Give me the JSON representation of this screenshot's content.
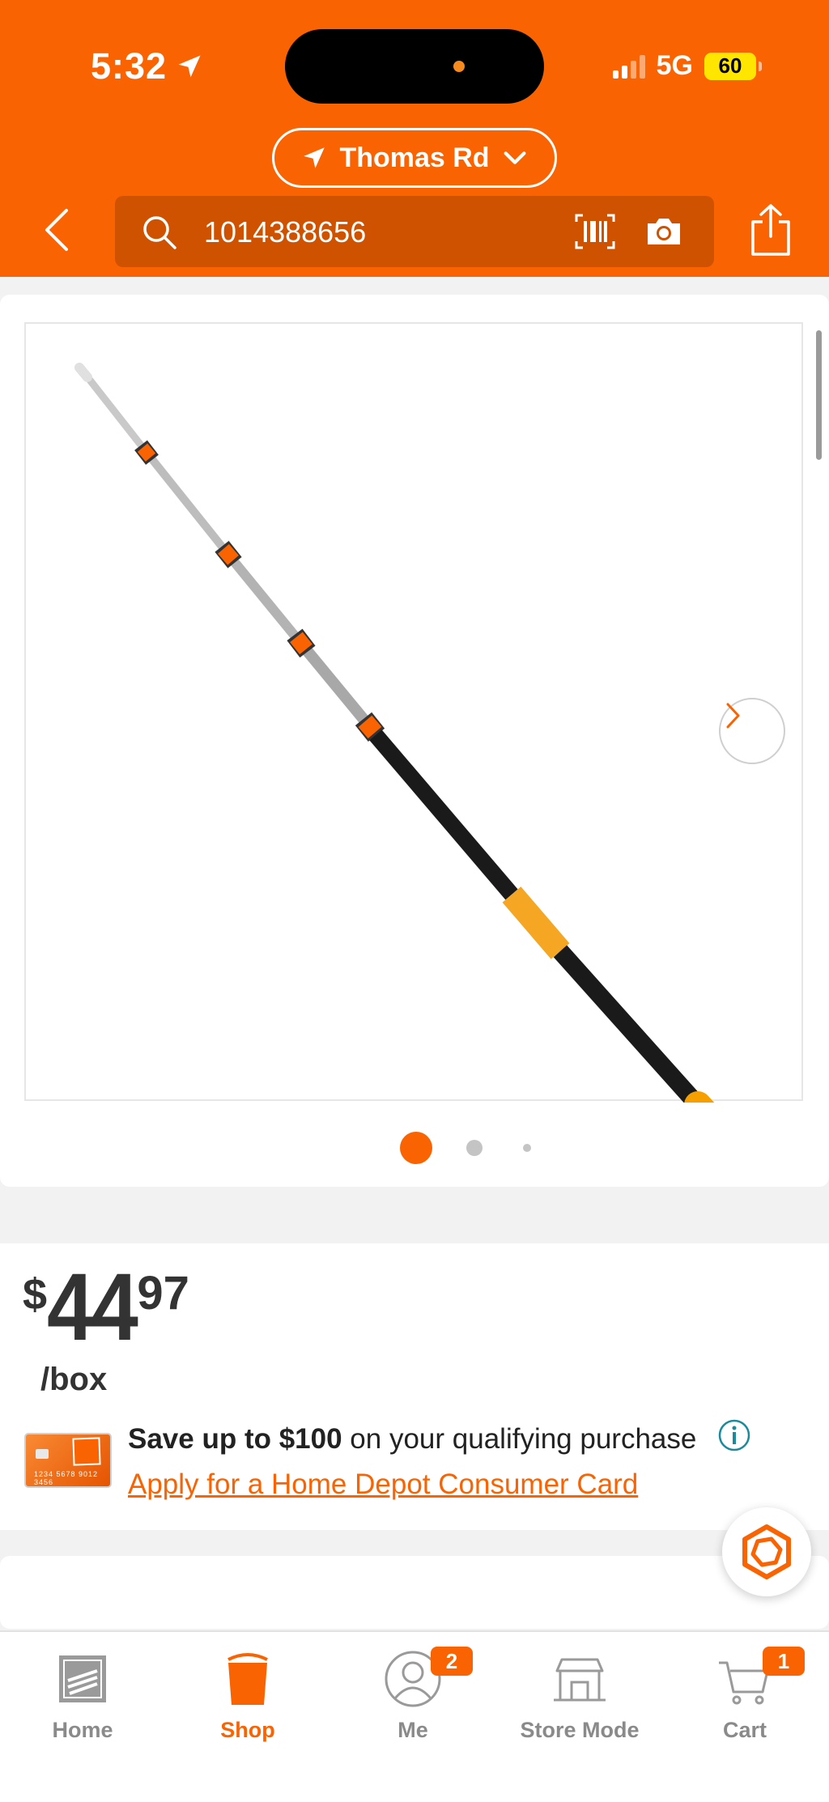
{
  "status_bar": {
    "time": "5:32",
    "network": "5G",
    "battery": "60"
  },
  "header": {
    "store_name": "Thomas Rd",
    "search_value": "1014388656"
  },
  "gallery": {
    "image_alt": "telescoping pole",
    "current_index": 1,
    "total": 3
  },
  "price": {
    "dollar_sign": "$",
    "whole": "44",
    "cents": "97",
    "unit": "/box"
  },
  "promo": {
    "bold_text": "Save up to $100",
    "text": " on your qualifying purchase",
    "link": "Apply for a Home Depot Consumer Card",
    "card_number": "1234 5678 9012 3456"
  },
  "nav": {
    "items": [
      {
        "label": "Home",
        "badge": ""
      },
      {
        "label": "Shop",
        "badge": ""
      },
      {
        "label": "Me",
        "badge": "2"
      },
      {
        "label": "Store Mode",
        "badge": ""
      },
      {
        "label": "Cart",
        "badge": "1"
      }
    ],
    "active": "Shop"
  },
  "colors": {
    "brand": "#f96302",
    "search_bg": "#cf5200",
    "battery": "#ffe600"
  }
}
